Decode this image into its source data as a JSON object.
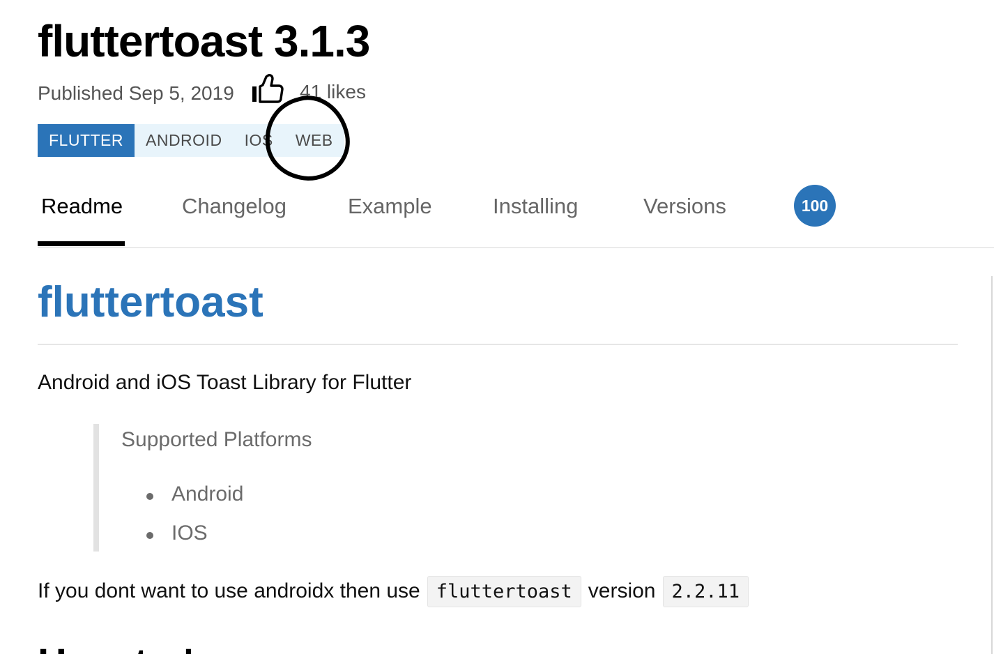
{
  "package": {
    "title": "fluttertoast 3.1.3",
    "published": "Published Sep 5, 2019",
    "likes": "41 likes",
    "tags": [
      "FLUTTER",
      "ANDROID",
      "IOS",
      "WEB"
    ]
  },
  "tabs": {
    "items": [
      "Readme",
      "Changelog",
      "Example",
      "Installing",
      "Versions"
    ],
    "active": "Readme",
    "score": "100"
  },
  "readme": {
    "title": "fluttertoast",
    "description": "Android and iOS Toast Library for Flutter",
    "quote": {
      "title": "Supported Platforms",
      "items": [
        "Android",
        "IOS"
      ]
    },
    "androidx": {
      "prefix": "If you dont want to use androidx then use",
      "code1": "fluttertoast",
      "middle": "version",
      "code2": "2.2.11"
    },
    "next_heading": "How to Use"
  },
  "colors": {
    "accent": "#2b74b8",
    "tag_bg": "#e8f4fb",
    "text_muted": "#555555"
  }
}
